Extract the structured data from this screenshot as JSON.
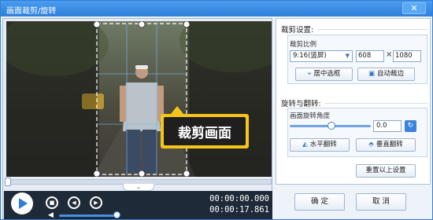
{
  "window": {
    "title": "画面裁剪/旋转",
    "close_label": "✕"
  },
  "preview": {
    "overlay_label": "裁剪画面",
    "time_current": "00:00:00.000",
    "time_total": "00:00:17.861",
    "collapse_label": "⌄"
  },
  "crop": {
    "section_title": "裁剪设置:",
    "ratio_label": "裁剪比例",
    "ratio_value": "9:16(竖屏)",
    "width_value": "608",
    "height_value": "1080",
    "times_sign": "×",
    "center_button": "居中选框",
    "auto_crop_button": "自动裁边"
  },
  "rotate": {
    "section_title": "旋转与翻转:",
    "angle_label": "画面旋转角度",
    "angle_value": "0.0",
    "hflip_button": "水平翻转",
    "vflip_button": "垂直翻转"
  },
  "reset_button": "重置以上设置",
  "footer": {
    "ok_button": "确 定",
    "cancel_button": "取 消"
  },
  "colors": {
    "accent": "#2e7fd9",
    "highlight": "#f5c518"
  },
  "icons": {
    "play": "play-icon",
    "stop": "stop-icon",
    "prev": "previous-icon",
    "next": "next-icon",
    "volume": "volume-icon",
    "center": "center-icon",
    "auto": "auto-crop-icon",
    "hflip": "flip-horizontal-icon",
    "vflip": "flip-vertical-icon",
    "rotate": "rotate-icon"
  }
}
